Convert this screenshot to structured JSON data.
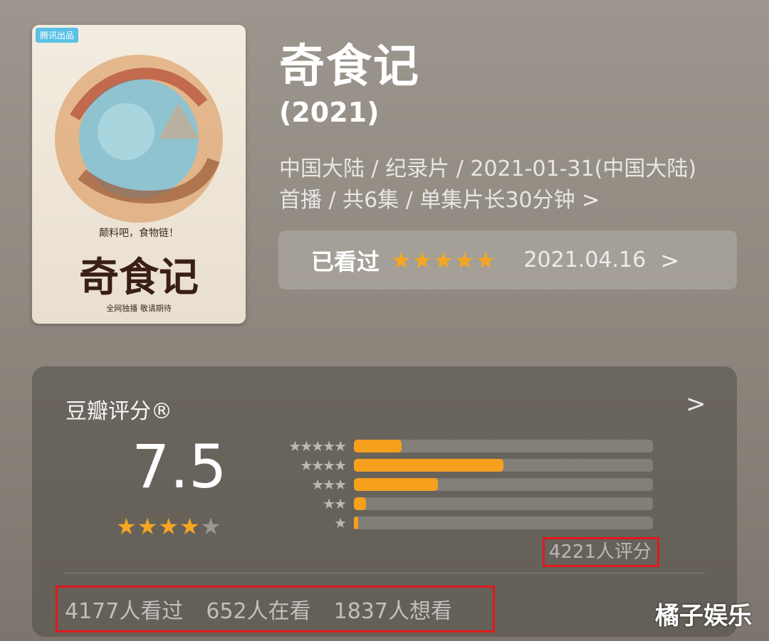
{
  "poster": {
    "badge": "腾讯出品",
    "slogan": "颠料吧，食物链！",
    "title_art": "奇食记",
    "subtitle": "全网独播   敬请期待"
  },
  "header": {
    "title": "奇食记",
    "year": "(2021)",
    "meta_line1": "中国大陆 / 纪录片 / 2021-01-31(中国大陆)",
    "meta_line2": "首播 / 共6集 / 单集片长30分钟",
    "meta_chevron": ">"
  },
  "watched": {
    "label": "已看过",
    "stars_count": 5,
    "date": "2021.04.16",
    "chevron": ">"
  },
  "rating": {
    "title": "豆瓣评分®",
    "chevron": ">",
    "score": "7.5",
    "score_stars": 4,
    "distribution": [
      {
        "stars": 5,
        "fraction": 0.16
      },
      {
        "stars": 4,
        "fraction": 0.5
      },
      {
        "stars": 3,
        "fraction": 0.28
      },
      {
        "stars": 2,
        "fraction": 0.04
      },
      {
        "stars": 1,
        "fraction": 0.015
      }
    ],
    "raters": "4221人评分"
  },
  "stats": {
    "watched": "4177人看过",
    "watching": "652人在看",
    "wish": "1837人想看"
  },
  "watermark": "橘子娱乐",
  "colors": {
    "star": "#f5a623",
    "bar": "#f5a11e",
    "highlight_border": "#e0191c"
  }
}
